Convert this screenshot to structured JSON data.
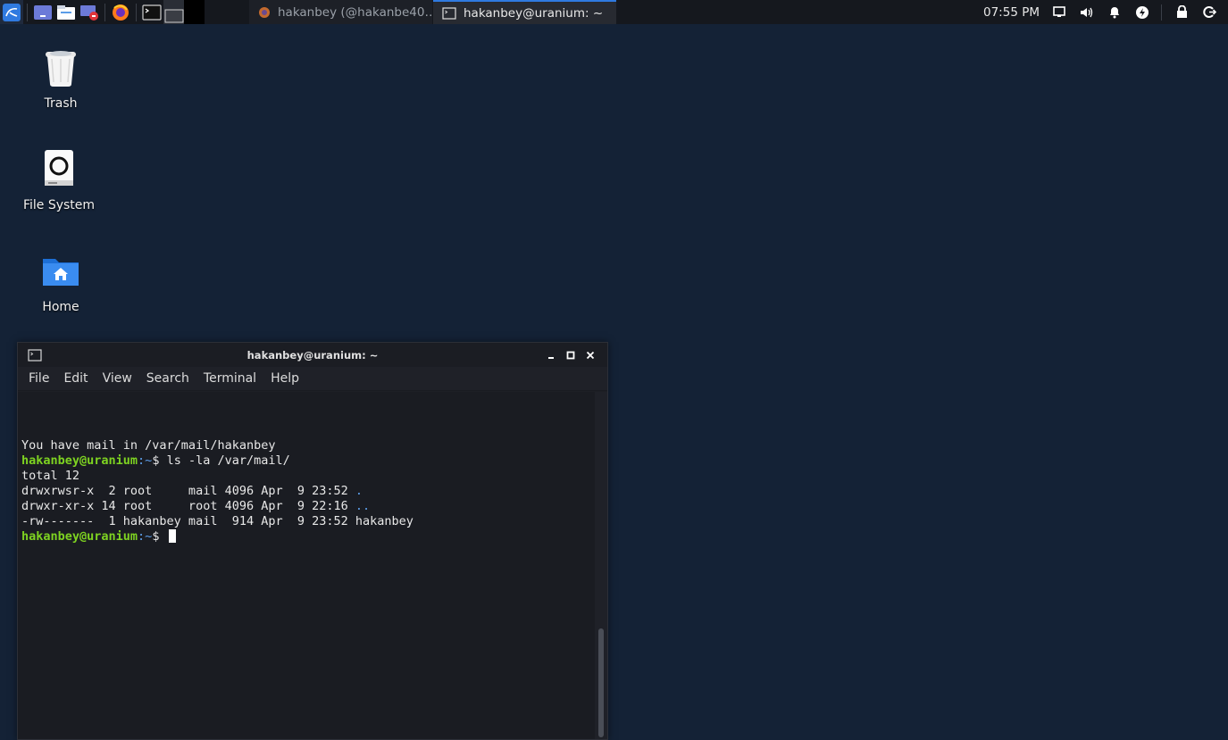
{
  "panel": {
    "launcher_icons": [
      "kali-menu-icon",
      "show-desktop-icon",
      "file-manager-icon",
      "screenshot-icon",
      "firefox-icon",
      "terminal-icon"
    ],
    "tasks": [
      {
        "label": "hakanbey (@hakanbe40…",
        "icon": "firefox-icon",
        "active": false
      },
      {
        "label": "hakanbey@uranium: ~",
        "icon": "terminal-icon",
        "active": true
      }
    ],
    "clock": "07:55 PM",
    "tray_icons": [
      "display-icon",
      "volume-icon",
      "notification-bell-icon",
      "power-manager-icon",
      "lock-icon",
      "logout-icon"
    ]
  },
  "desktop": {
    "icons": [
      {
        "label": "Trash"
      },
      {
        "label": "File System"
      },
      {
        "label": "Home"
      }
    ]
  },
  "terminal": {
    "title": "hakanbey@uranium: ~",
    "menu": [
      "File",
      "Edit",
      "View",
      "Search",
      "Terminal",
      "Help"
    ],
    "lines": {
      "mail_notice": "You have mail in /var/mail/hakanbey",
      "prompt_user": "hakanbey@uranium",
      "prompt_path": ":~",
      "prompt_sign": "$ ",
      "command": "ls -la /var/mail/",
      "total": "total 12",
      "row1_prefix": "drwxrwsr-x  2 root     mail 4096 Apr  9 23:52 ",
      "row1_name": ".",
      "row2_prefix": "drwxr-xr-x 14 root     root 4096 Apr  9 22:16 ",
      "row2_name": "..",
      "row3": "-rw-------  1 hakanbey mail  914 Apr  9 23:52 hakanbey"
    }
  },
  "colors": {
    "desktop_bg": "#142236",
    "prompt_green": "#7ed321",
    "dir_blue": "#5c9de8",
    "active_task_accent": "#2f7ae0"
  }
}
